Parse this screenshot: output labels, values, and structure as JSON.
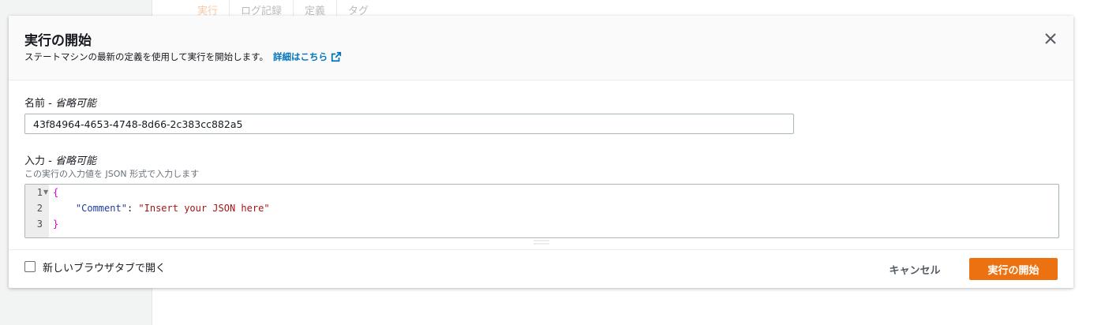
{
  "background": {
    "tabs": [
      {
        "label": "実行",
        "active": true
      },
      {
        "label": "ログ記録",
        "active": false
      },
      {
        "label": "定義",
        "active": false
      },
      {
        "label": "タグ",
        "active": false
      }
    ]
  },
  "modal": {
    "title": "実行の開始",
    "description": "ステートマシンの最新の定義を使用して実行を開始します。",
    "learn_more": "詳細はこちら",
    "learn_more_icon": "external-link-icon",
    "close_icon": "close-icon"
  },
  "name_field": {
    "label": "名前 - ",
    "optional": "省略可能",
    "value": "43f84964-4653-4748-8d66-2c383cc882a5"
  },
  "input_field": {
    "label": "入力 - ",
    "optional": "省略可能",
    "hint": "この実行の入力値を JSON 形式で入力します",
    "line_numbers": [
      "1",
      "2",
      "3"
    ],
    "code": {
      "open_brace": "{",
      "indent": "    ",
      "key": "\"Comment\"",
      "colon": ": ",
      "value": "\"Insert your JSON here\"",
      "close_brace": "}"
    }
  },
  "footer": {
    "checkbox_label": "新しいブラウザタブで開く",
    "checkbox_checked": false,
    "cancel_label": "キャンセル",
    "start_label": "実行の開始"
  },
  "colors": {
    "primary_button": "#ec7211",
    "link": "#0073bb",
    "brace": "#d100d1",
    "json_key": "#1f3ba3",
    "json_string": "#a31515"
  }
}
